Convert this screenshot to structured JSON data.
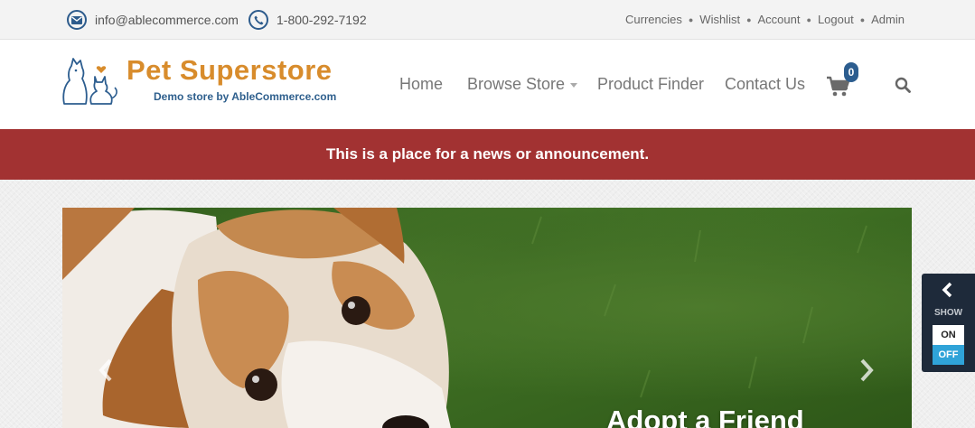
{
  "topbar": {
    "email": "info@ablecommerce.com",
    "phone": "1-800-292-7192",
    "email_icon": "envelope-icon",
    "phone_icon": "phone-icon",
    "links": [
      "Currencies",
      "Wishlist",
      "Account",
      "Logout",
      "Admin"
    ]
  },
  "logo": {
    "title": "Pet Superstore",
    "subtitle": "Demo store by AbleCommerce.com"
  },
  "nav": {
    "home": "Home",
    "browse": "Browse Store",
    "finder": "Product Finder",
    "contact": "Contact Us",
    "cart_count": "0",
    "cart_icon": "shopping-cart-icon",
    "search_icon": "search-icon"
  },
  "announcement": "This is a place for a news or announcement.",
  "hero": {
    "caption": "Adopt a Friend"
  },
  "widget": {
    "show": "SHOW",
    "on": "ON",
    "off": "OFF"
  },
  "colors": {
    "brand_blue": "#2c5d8f",
    "brand_orange": "#d88c2c",
    "announcement_red": "#a23232",
    "toggle_blue": "#2fa3d8"
  }
}
